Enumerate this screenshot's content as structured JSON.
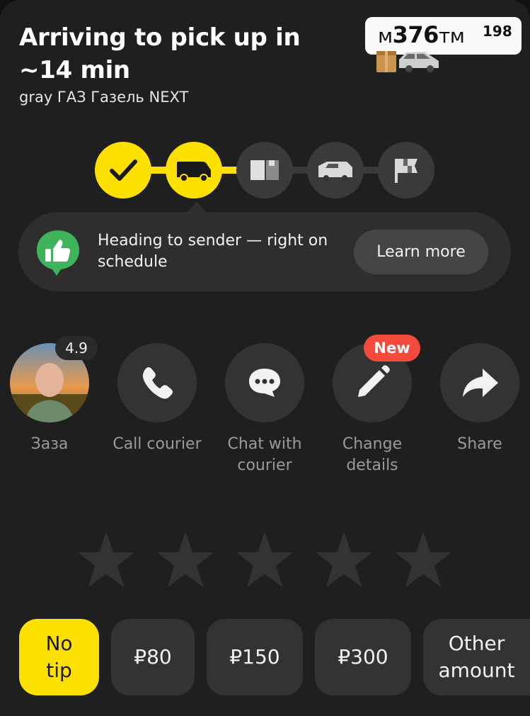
{
  "header": {
    "title": "Arriving to pick up in ~14 min",
    "subtitle": "gray ГАЗ Газель NEXT"
  },
  "plate": {
    "letter1": "м",
    "digits": "376",
    "letters2": "тм",
    "region": "198"
  },
  "progress": {
    "steps": [
      "check-icon",
      "truck-icon",
      "box-icon",
      "van-icon",
      "flag-icon"
    ],
    "completed_steps": 2,
    "active_color": "#fce000",
    "inactive_color": "#3a3a3a"
  },
  "banner": {
    "icon": "thumbs-up-icon",
    "text": "Heading to sender — right on schedule",
    "button": "Learn more"
  },
  "actions": {
    "courier": {
      "name": "Заза",
      "rating": "4.9"
    },
    "call": {
      "label": "Call courier",
      "icon": "phone-icon"
    },
    "chat": {
      "label": "Chat with courier",
      "icon": "chat-icon"
    },
    "change": {
      "label": "Change details",
      "icon": "pencil-icon",
      "badge": "New"
    },
    "share": {
      "label": "Share",
      "icon": "share-icon"
    }
  },
  "rating_stars": {
    "count": 5,
    "selected": 0
  },
  "tips": {
    "no_tip": "No tip",
    "t80": "₽80",
    "t150": "₽150",
    "t300": "₽300",
    "other": "Other amount",
    "selected": "No tip"
  }
}
